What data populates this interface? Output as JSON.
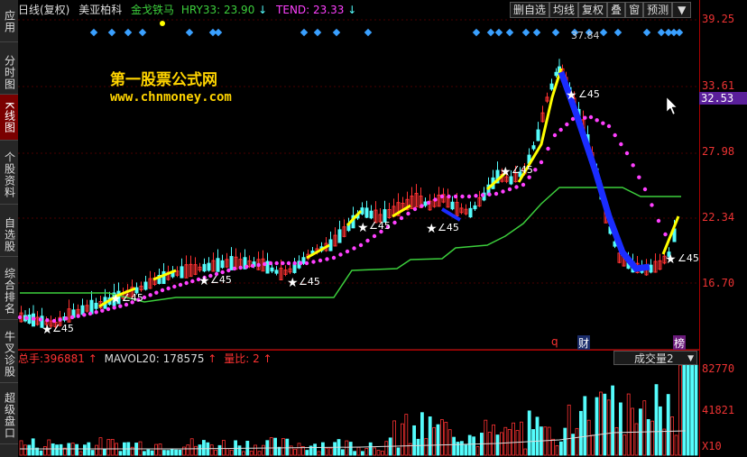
{
  "sidebar": {
    "items": [
      {
        "label": "应用"
      },
      {
        "label": "分时图"
      },
      {
        "label": "K线图"
      },
      {
        "label": "个股资料"
      },
      {
        "label": "自选股"
      },
      {
        "label": "综合排名"
      },
      {
        "label": "牛叉诊股"
      },
      {
        "label": "超级盘口"
      }
    ]
  },
  "header": {
    "period": "日线(复权)",
    "stock_name": "美亚柏科",
    "indicator": "金戈铁马",
    "hry_label": "HRY33:",
    "hry_value": "23.90",
    "tend_label": "TEND:",
    "tend_value": "23.33",
    "arrow_down": "↓"
  },
  "toolbar": {
    "remove_favorite": "删自选",
    "ma_lines": "均线",
    "adjust": "复权",
    "overlay": "叠",
    "window": "窗",
    "forecast": "预测",
    "menu": "▼"
  },
  "watermark": {
    "title": "第一股票公式网",
    "url": "www.chnmoney.com"
  },
  "price_axis": {
    "ticks": [
      "39.25",
      "33.61",
      "27.98",
      "22.34",
      "16.70"
    ],
    "current": "32.53"
  },
  "annotations": {
    "peak_price": "37.84",
    "angle_label": "∠45",
    "marker_q": "q",
    "marker_cai": "财",
    "marker_bang": "榜"
  },
  "volume": {
    "total_label": "总手:",
    "total_value": "396881",
    "mavol_label": "MAVOL20:",
    "mavol_value": "178575",
    "ratio_label": "量比:",
    "ratio_value": "2",
    "up_arrow": "↑",
    "select_value": "成交量2",
    "select_arrow": "▼",
    "ticks": [
      "82770",
      "41821"
    ],
    "multiplier": "X10"
  },
  "colors": {
    "up": "#ff3232",
    "down": "#54fcfc",
    "green_line": "#3ccf3c",
    "yellow": "#ffff00",
    "magenta": "#ff40ff",
    "blue": "#1a2cff",
    "diamond": "#3aa0ff",
    "axis_red": "#d02020"
  }
}
